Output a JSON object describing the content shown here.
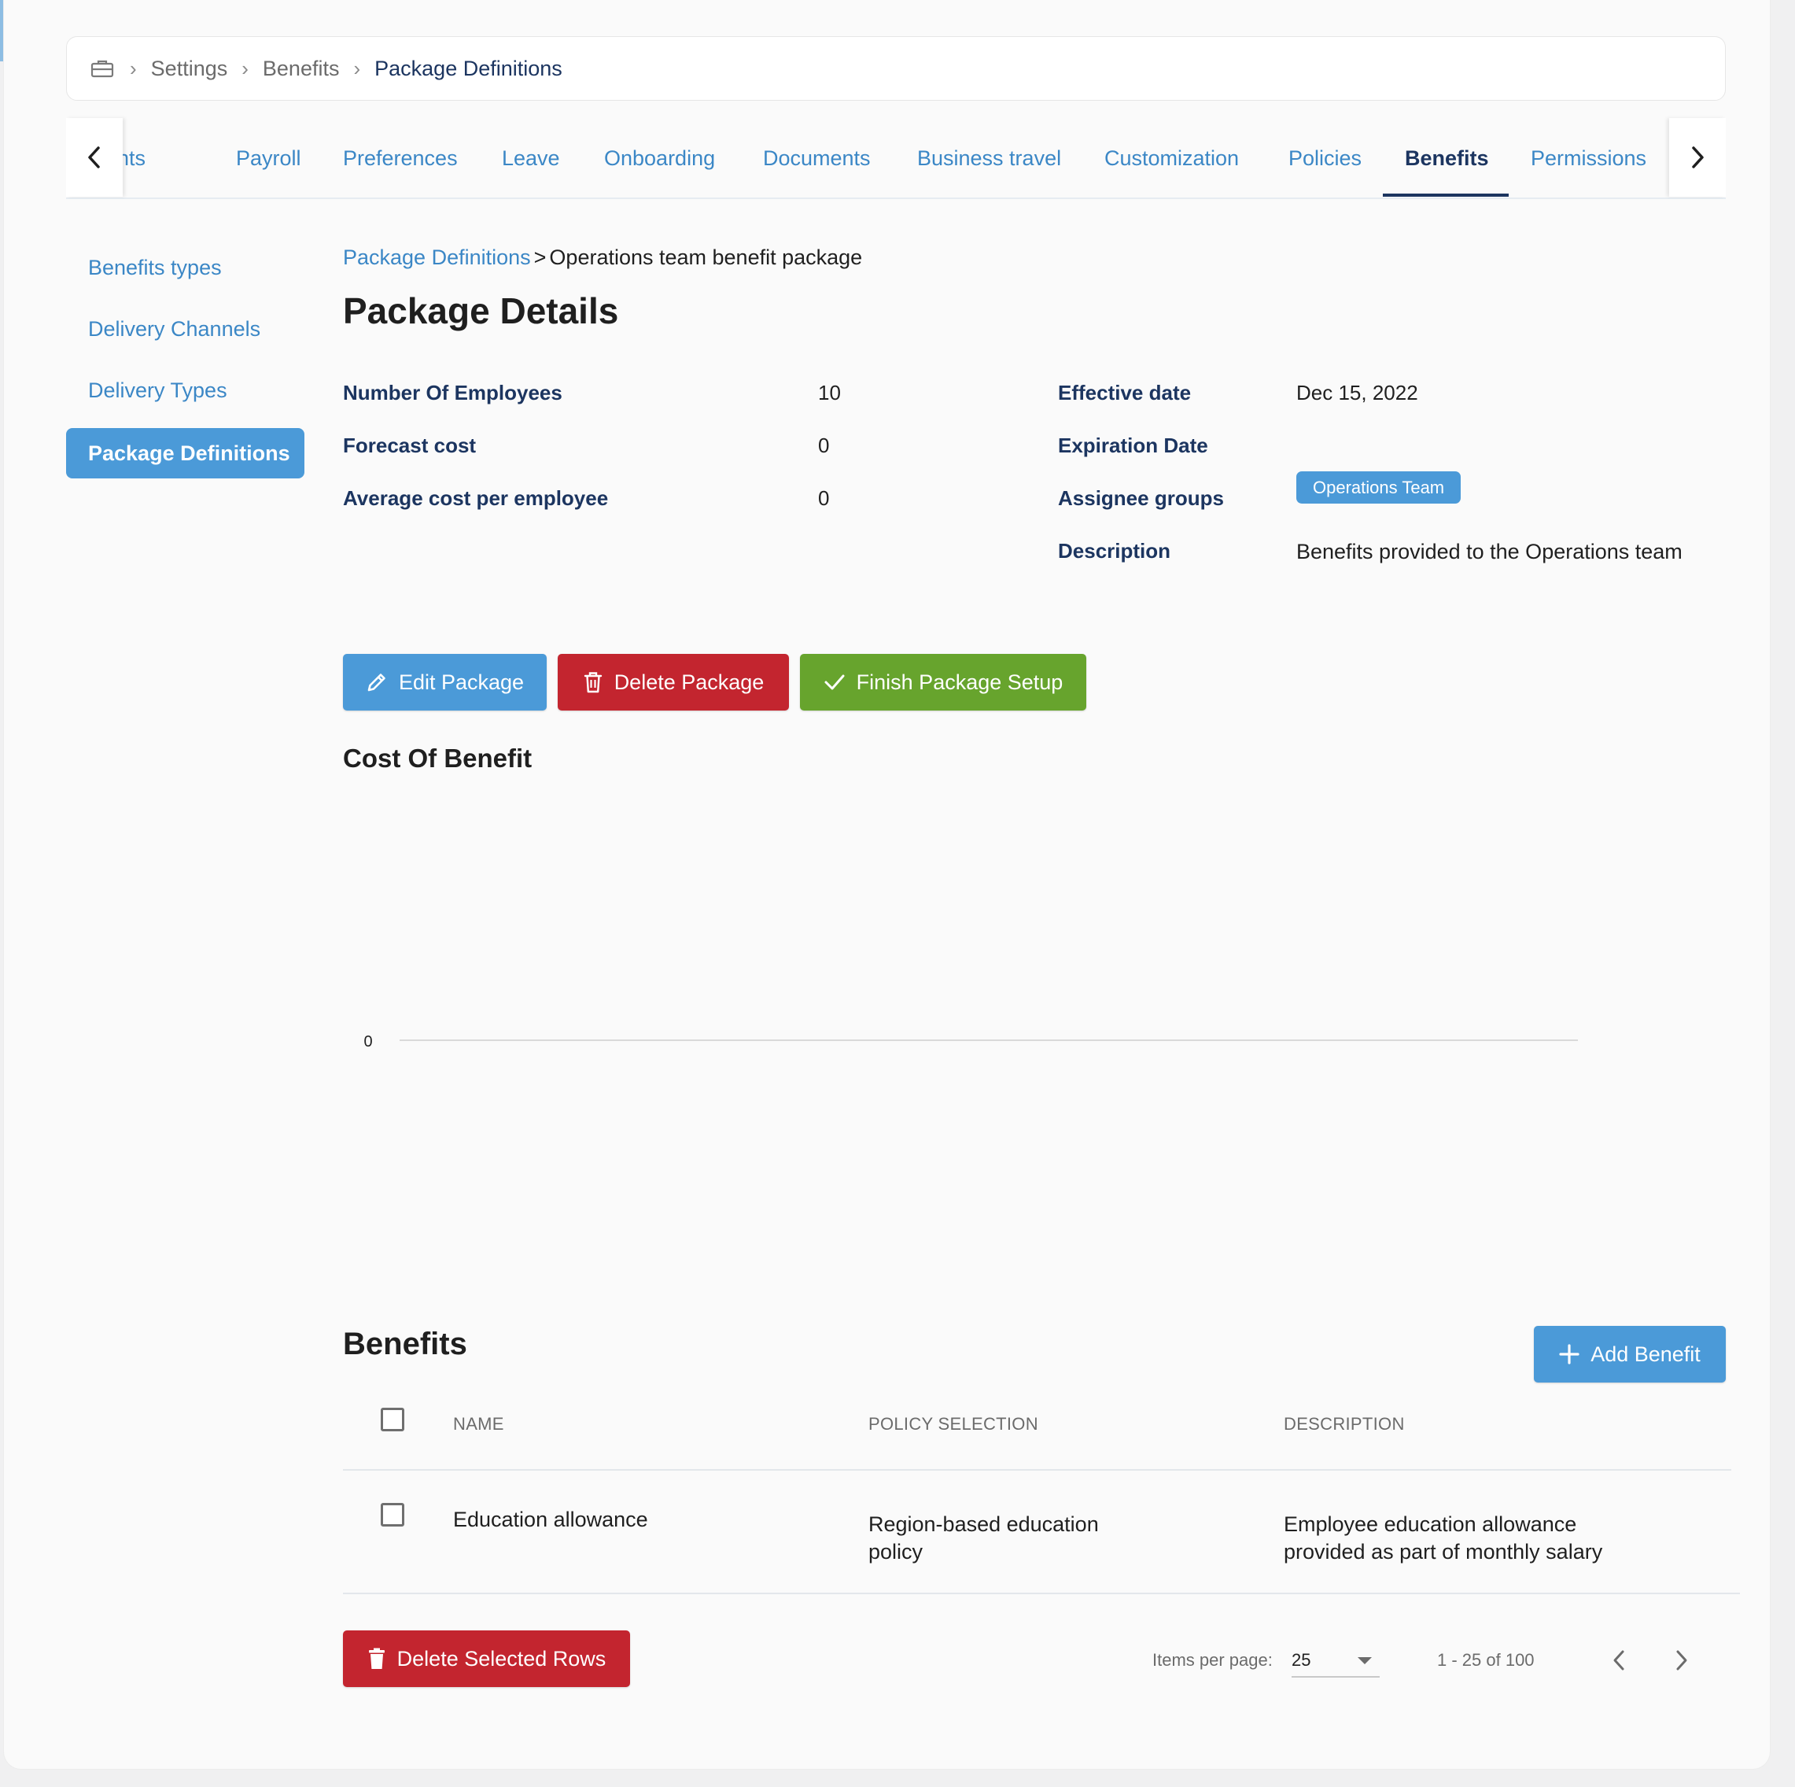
{
  "breadcrumb": {
    "icon": "briefcase-icon",
    "items": [
      "Settings",
      "Benefits",
      "Package Definitions"
    ]
  },
  "tabs": [
    "Accounts",
    "Payroll",
    "Preferences",
    "Leave",
    "Onboarding",
    "Documents",
    "Business travel",
    "Customization",
    "Policies",
    "Benefits",
    "Permissions"
  ],
  "active_tab": "Benefits",
  "sidenav": {
    "items": [
      "Benefits types",
      "Delivery Channels",
      "Delivery Types",
      "Package Definitions"
    ],
    "active": "Package Definitions"
  },
  "subcrumb": {
    "link": "Package Definitions",
    "separator": ">",
    "current": "Operations team benefit package"
  },
  "page_title": "Package Details",
  "details": {
    "employees_label": "Number Of Employees",
    "employees_value": "10",
    "forecast_label": "Forecast cost",
    "forecast_value": "0",
    "avg_label": "Average cost per employee",
    "avg_value": "0",
    "effective_label": "Effective date",
    "effective_value": "Dec 15, 2022",
    "expiration_label": "Expiration Date",
    "expiration_value": "",
    "assignee_label": "Assignee groups",
    "assignee_badge": "Operations Team",
    "description_label": "Description",
    "description_value": "Benefits provided to the Operations team"
  },
  "actions": {
    "edit": "Edit Package",
    "delete": "Delete Package",
    "finish": "Finish Package Setup"
  },
  "colors": {
    "primary": "#4b9ad8",
    "danger": "#c3252f",
    "success": "#67a42d",
    "navy": "#1c3560",
    "link": "#3b87c6"
  },
  "cost_section": {
    "title": "Cost Of Benefit"
  },
  "chart_data": {
    "type": "line",
    "title": "",
    "xlabel": "",
    "ylabel": "",
    "y_ticks": [
      "0"
    ],
    "series": [],
    "grid": false
  },
  "benefits_section": {
    "title": "Benefits",
    "add_label": "Add Benefit",
    "columns": [
      "NAME",
      "POLICY SELECTION",
      "DESCRIPTION"
    ],
    "rows": [
      {
        "name": "Education allowance",
        "policy": "Region-based education policy",
        "description": "Employee education allowance provided as part of monthly salary"
      }
    ],
    "delete_selected_label": "Delete Selected Rows"
  },
  "pagination": {
    "items_per_page_label": "Items per page:",
    "items_per_page": "25",
    "range": "1 - 25 of 100"
  }
}
